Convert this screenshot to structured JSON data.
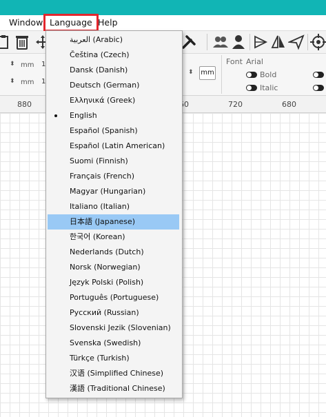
{
  "menubar": {
    "items": [
      {
        "label": "Window"
      },
      {
        "label": "Language"
      },
      {
        "label": "Help"
      }
    ]
  },
  "properties": {
    "unit_left_1": "mm",
    "unit_left_2": "mm",
    "value_left_1": "1",
    "value_left_2": "1",
    "unit_button": "mm",
    "font_label": "Font",
    "font_value": "Arial",
    "bold_label": "Bold",
    "italic_label": "Italic"
  },
  "ruler": {
    "labels": [
      "880",
      "60",
      "720",
      "680"
    ]
  },
  "language_menu": {
    "items": [
      {
        "label": "العربية (Arabic)"
      },
      {
        "label": "Čeština (Czech)"
      },
      {
        "label": "Dansk (Danish)"
      },
      {
        "label": "Deutsch (German)"
      },
      {
        "label": "Ελληνικά (Greek)"
      },
      {
        "label": "English",
        "checked": true
      },
      {
        "label": "Español (Spanish)"
      },
      {
        "label": "Español (Latin American)"
      },
      {
        "label": "Suomi (Finnish)"
      },
      {
        "label": "Français (French)"
      },
      {
        "label": "Magyar (Hungarian)"
      },
      {
        "label": "Italiano (Italian)"
      },
      {
        "label": "日本語 (Japanese)",
        "highlighted": true
      },
      {
        "label": "한국어 (Korean)"
      },
      {
        "label": "Nederlands (Dutch)"
      },
      {
        "label": "Norsk (Norwegian)"
      },
      {
        "label": "Język Polski (Polish)"
      },
      {
        "label": "Português (Portuguese)"
      },
      {
        "label": "Русский (Russian)"
      },
      {
        "label": "Slovenski Jezik (Slovenian)"
      },
      {
        "label": "Svenska (Swedish)"
      },
      {
        "label": "Türkçe (Turkish)"
      },
      {
        "label": "汉语 (Simplified Chinese)"
      },
      {
        "label": "漢語 (Traditional Chinese)"
      }
    ]
  },
  "colors": {
    "title_strip": "#11b5b5",
    "menu_highlight_outline": "#e3262d",
    "selected_item_bg": "#99c9f5"
  }
}
